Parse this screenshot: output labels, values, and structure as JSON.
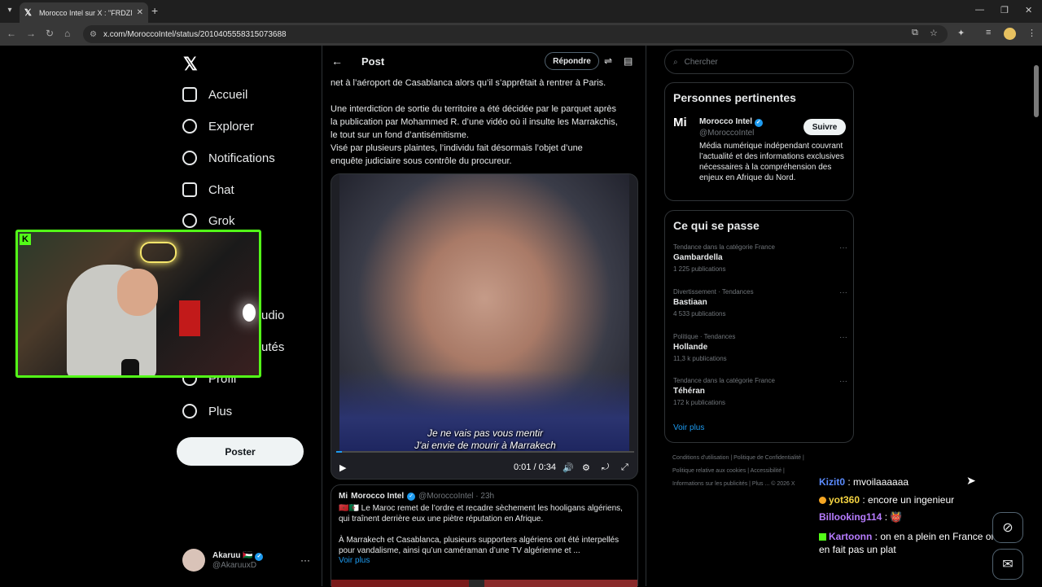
{
  "browser": {
    "tab_title": "Morocco Intel sur X : \"FRDZMA| ...",
    "url": "x.com/MoroccoIntel/status/2010405558315073688",
    "new_tab": "+",
    "window_controls": [
      "—",
      "❐",
      "✕"
    ]
  },
  "nav": {
    "items": [
      {
        "label": "Accueil",
        "icon": "home-icon"
      },
      {
        "label": "Explorer",
        "icon": "search-icon"
      },
      {
        "label": "Notifications",
        "icon": "bell-icon"
      },
      {
        "label": "Chat",
        "icon": "mail-icon"
      },
      {
        "label": "Grok",
        "icon": "grok-icon"
      },
      {
        "label": "udio",
        "icon": ""
      },
      {
        "label": "utés",
        "icon": ""
      },
      {
        "label": "Profil",
        "icon": "user-icon"
      },
      {
        "label": "Plus",
        "icon": "more-circle-icon"
      }
    ],
    "post_button": "Poster",
    "account": {
      "name": "Akaruu 🇵🇸",
      "handle": "@AkaruuxD"
    }
  },
  "post": {
    "header_title": "Post",
    "reply_button": "Répondre",
    "text_lines": [
      "net à l’aéroport de Casablanca alors qu’il s’apprêtait à rentrer à Paris.",
      "",
      "Une interdiction de sortie du territoire a été décidée par le parquet après",
      "la publication par Mohammed R. d’une vidéo où il insulte les Marrakchis,",
      "le tout sur un fond d’antisémitisme.",
      "Visé par plusieurs plaintes, l’individu fait désormais l’objet d’une",
      "enquête judiciaire sous contrôle du procureur."
    ],
    "video": {
      "subtitle_1": "Je ne vais pas vous mentir",
      "subtitle_2": "J'ai envie de mourir à Marrakech",
      "time": "0:01 / 0:34",
      "progress": 0.02
    },
    "quote": {
      "name": "Morocco Intel",
      "meta": "@MoroccoIntel · 23h",
      "line1": "🇲🇦🇩🇿 Le Maroc remet de l’ordre et recadre sèchement les hooligans algériens,",
      "line2": "qui traînent derrière eux une piètre réputation en Afrique.",
      "line3": "À Marrakech et Casablanca, plusieurs supporters algériens ont été interpellés",
      "line4": "pour vandalisme, ainsi qu’un caméraman d’une TV algérienne et  ...",
      "more": "Voir plus"
    }
  },
  "sidebar": {
    "search_placeholder": "Chercher",
    "relevant": {
      "title": "Personnes pertinentes",
      "name": "Morocco Intel",
      "handle": "@MoroccoIntel",
      "follow": "Suivre",
      "bio": "Média numérique indépendant couvrant l’actualité et des informations exclusives nécessaires à la compréhension des enjeux en Afrique du Nord."
    },
    "trends": {
      "title": "Ce qui se passe",
      "items": [
        {
          "category": "Tendance dans la catégorie France",
          "topic": "Gambardella",
          "count": "1 225 publications"
        },
        {
          "category": "Divertissement · Tendances",
          "topic": "Bastiaan",
          "count": "4 533 publications"
        },
        {
          "category": "Politique · Tendances",
          "topic": "Hollande",
          "count": "11,3 k publications"
        },
        {
          "category": "Tendance dans la catégorie France",
          "topic": "Téhéran",
          "count": "172 k publications"
        }
      ],
      "more": "Voir plus"
    },
    "footer": {
      "line1": "Conditions d'utilisation  |  Politique de Confidentialité  |",
      "line2": "Politique relative aux cookies  |  Accessibilité  |",
      "line3": "Informations sur les publicités  |  Plus ...  © 2026 X"
    }
  },
  "chat": [
    {
      "user": "Kizit0",
      "color": "#5b8cff",
      "msg": "mvoilaaaaaa"
    },
    {
      "user": "yot360",
      "color": "#f5d442",
      "msg": "encore un ingenieur"
    },
    {
      "user": "Billooking114",
      "color": "#b77cff",
      "msg": "👹"
    },
    {
      "user": "Kartoonn",
      "color": "#b77cff",
      "msg": "on en a plein en France on"
    },
    {
      "user": "",
      "color": "#ffffff",
      "msg": "en fait pas un plat"
    }
  ]
}
